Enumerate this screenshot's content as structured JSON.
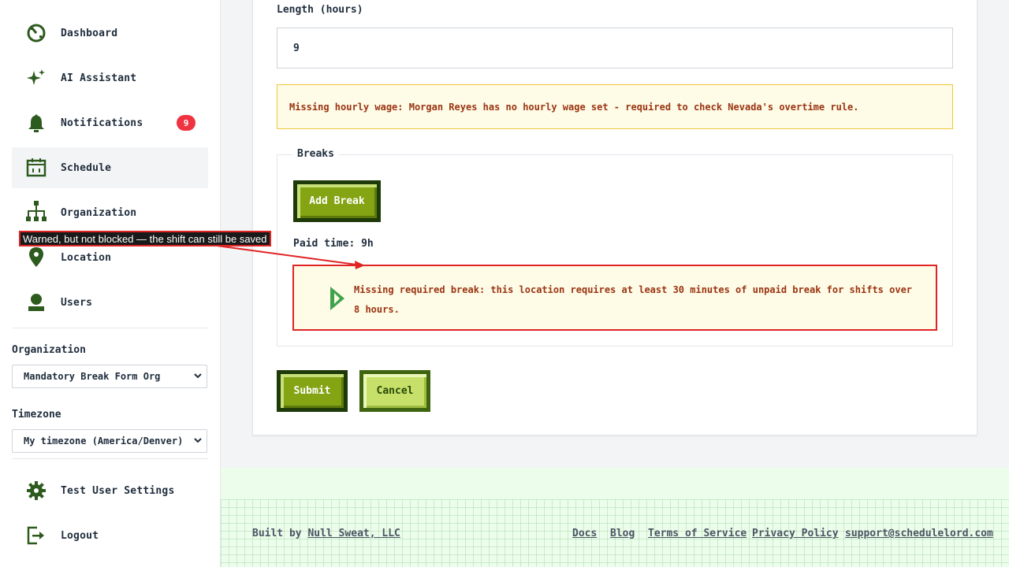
{
  "sidebar": {
    "items": [
      {
        "label": "Dashboard",
        "icon": "dashboard-icon"
      },
      {
        "label": "AI Assistant",
        "icon": "sparkle-icon"
      },
      {
        "label": "Notifications",
        "icon": "bell-icon",
        "badge": "9"
      },
      {
        "label": "Schedule",
        "icon": "calendar-icon",
        "active": true
      },
      {
        "label": "Organization",
        "icon": "org-chart-icon"
      },
      {
        "label": "Location",
        "icon": "map-pin-icon"
      },
      {
        "label": "Users",
        "icon": "user-icon"
      }
    ],
    "organization_label": "Organization",
    "organization_value": "Mandatory Break Form Org",
    "timezone_label": "Timezone",
    "timezone_value": "My timezone (America/Denver)",
    "bottom_items": [
      {
        "label": "Test User Settings",
        "icon": "gear-icon"
      },
      {
        "label": "Logout",
        "icon": "logout-icon"
      }
    ]
  },
  "form": {
    "length_label": "Length (hours)",
    "length_value": "9",
    "wage_warning": "Missing hourly wage: Morgan Reyes has no hourly wage set - required to check Nevada's overtime rule.",
    "breaks_legend": "Breaks",
    "add_break_label": "Add Break",
    "paid_time": "Paid time: 9h",
    "break_warning": "Missing required break: this location requires at least 30 minutes of unpaid break for shifts over 8 hours.",
    "submit_label": "Submit",
    "cancel_label": "Cancel"
  },
  "annotation": {
    "text": "Warned, but not blocked — the shift can still be saved"
  },
  "footer": {
    "built_by_prefix": "Built by ",
    "built_by_link": "Null Sweat, LLC",
    "links": [
      "Docs",
      "Blog",
      "Terms of Service",
      "Privacy Policy",
      "support@schedulelord.com"
    ]
  },
  "colors": {
    "accent_green": "#84a414",
    "dark_green": "#1e3a08",
    "warning_bg": "#fefbe6",
    "warning_text": "#9a3412",
    "error_red": "#e02424",
    "badge_red": "#ef3340"
  }
}
